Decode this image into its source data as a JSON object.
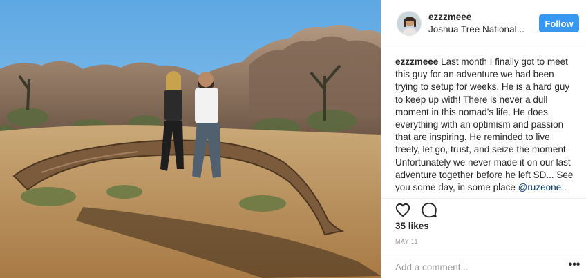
{
  "post": {
    "photo_alt": "",
    "colors": {
      "sky": "#6fb3e6",
      "ground": "#b98a55",
      "rock": "#8a6e58"
    }
  },
  "header": {
    "username": "ezzzmeee",
    "location": "Joshua Tree National...",
    "follow_label": "Follow",
    "avatar_icon": "user-avatar"
  },
  "caption": {
    "username": "ezzzmeee",
    "text": "Last month I finally got to meet this guy for an adventure we had been trying to setup for weeks. He is a hard guy to keep up with! There is never a dull moment in this nomad's life. He does everything with an optimism and passion that are inspiring. He reminded to live freely, let go, trust, and seize the moment. Unfortunately we never made it on our last adventure together before he left SD... See you some day, in some place",
    "mention": "@ruzeone",
    "trailing": " ."
  },
  "actions": {
    "like_icon": "heart-icon",
    "comment_icon": "comment-icon"
  },
  "likes": "35 likes",
  "date": "MAY 11",
  "comment": {
    "placeholder": "Add a comment...",
    "more_label": "•••"
  },
  "colors": {
    "follow": "#3897f0",
    "mention": "#003569",
    "border": "#efefef"
  }
}
